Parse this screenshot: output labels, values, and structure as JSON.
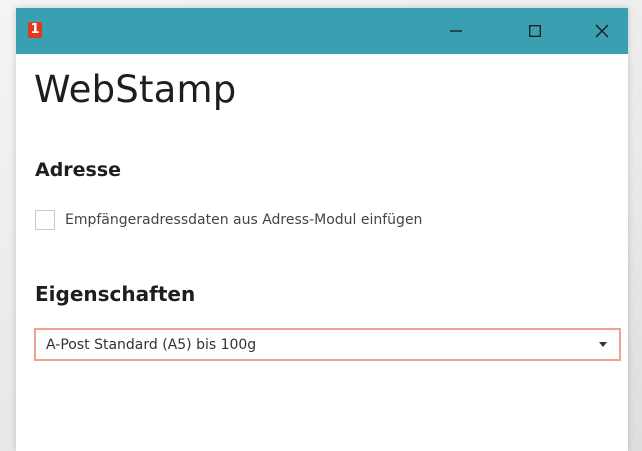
{
  "window": {
    "app_icon_glyph": "1",
    "controls": {
      "minimize": "minimize-icon",
      "maximize": "maximize-icon",
      "close": "close-icon"
    },
    "titlebar_color": "#3a9fb1",
    "app_icon_color": "#e03a1e"
  },
  "page": {
    "title": "WebStamp"
  },
  "address_section": {
    "heading": "Adresse",
    "checkbox_label": "Empfängeradressdaten aus Adress-Modul einfügen",
    "checkbox_checked": false
  },
  "properties_section": {
    "heading": "Eigenschaften",
    "product_select": {
      "selected": "A-Post Standard (A5) bis 100g",
      "border_color": "#f0a291"
    }
  }
}
